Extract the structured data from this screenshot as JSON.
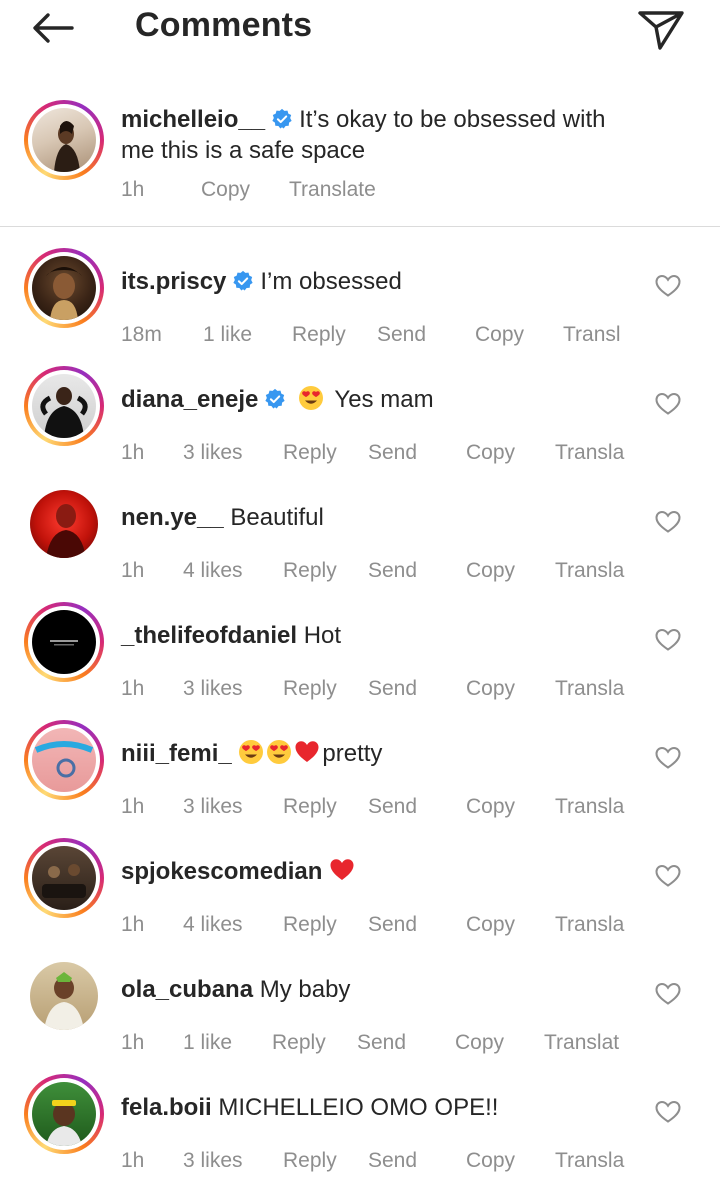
{
  "header": {
    "title": "Comments"
  },
  "caption": {
    "username": "michelleio__",
    "verified": true,
    "text_line1": "It’s okay to be obsessed with",
    "text_line2": "me this is a safe space",
    "time": "1h",
    "copy": "Copy",
    "translate": "Translate"
  },
  "comments": [
    {
      "username": "its.priscy",
      "verified": true,
      "text": "I’m obsessed",
      "time": "18m",
      "likes": "1 like",
      "reply": "Reply",
      "send": "Send",
      "copy": "Copy",
      "translate": "Transl"
    },
    {
      "username": "diana_eneje",
      "verified": true,
      "text": "Yes mam",
      "time": "1h",
      "likes": "3 likes",
      "reply": "Reply",
      "send": "Send",
      "copy": "Copy",
      "translate": "Transla"
    },
    {
      "username": "nen.ye__",
      "verified": false,
      "text": "Beautiful",
      "time": "1h",
      "likes": "4 likes",
      "reply": "Reply",
      "send": "Send",
      "copy": "Copy",
      "translate": "Transla"
    },
    {
      "username": "_thelifeofdaniel",
      "verified": false,
      "text": "Hot",
      "time": "1h",
      "likes": "3 likes",
      "reply": "Reply",
      "send": "Send",
      "copy": "Copy",
      "translate": "Transla"
    },
    {
      "username": "niii_femi_",
      "verified": false,
      "text": "pretty",
      "time": "1h",
      "likes": "3 likes",
      "reply": "Reply",
      "send": "Send",
      "copy": "Copy",
      "translate": "Transla"
    },
    {
      "username": "spjokescomedian",
      "verified": false,
      "text": "",
      "time": "1h",
      "likes": "4 likes",
      "reply": "Reply",
      "send": "Send",
      "copy": "Copy",
      "translate": "Transla"
    },
    {
      "username": "ola_cubana",
      "verified": false,
      "text": "My baby",
      "time": "1h",
      "likes": "1 like",
      "reply": "Reply",
      "send": "Send",
      "copy": "Copy",
      "translate": "Translat"
    },
    {
      "username": "fela.boii",
      "verified": false,
      "text": "MICHELLEIO OMO OPE!!",
      "time": "1h",
      "likes": "3 likes",
      "reply": "Reply",
      "send": "Send",
      "copy": "Copy",
      "translate": "Transla"
    }
  ],
  "icons": {
    "back": "arrow-left-icon",
    "direct": "paper-plane-icon",
    "like": "heart-outline-icon",
    "verified": "verified-badge-icon",
    "emoji_heart_eyes": "heart-eyes-emoji",
    "emoji_red_heart": "red-heart-emoji"
  },
  "colors": {
    "verified": "#3897f0",
    "secondary_text": "#8e8e8e",
    "divider": "#dbdbdb",
    "heart_emoji": "#e8262d"
  }
}
